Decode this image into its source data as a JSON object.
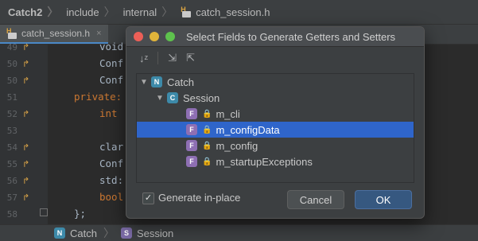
{
  "breadcrumb": {
    "items": [
      "Catch2",
      "include",
      "internal",
      "catch_session.h"
    ]
  },
  "tab": {
    "label": "catch_session.h",
    "close": "×"
  },
  "editor": {
    "lines": [
      {
        "n": "49",
        "text": "void"
      },
      {
        "n": "50",
        "text": "Conf"
      },
      {
        "n": "50",
        "text": "Conf"
      },
      {
        "n": "51",
        "text": "private:"
      },
      {
        "n": "52",
        "text": "int"
      },
      {
        "n": "53",
        "text": ""
      },
      {
        "n": "54",
        "text": "clar"
      },
      {
        "n": "55",
        "text": "Conf"
      },
      {
        "n": "56",
        "text": "std:"
      },
      {
        "n": "57",
        "text": "bool"
      },
      {
        "n": "58",
        "text": "};"
      }
    ]
  },
  "status_bar": {
    "items": [
      {
        "badge": "N",
        "label": "Catch"
      },
      {
        "badge": "S",
        "label": "Session"
      }
    ]
  },
  "dialog": {
    "title": "Select Fields to Generate Getters and Setters",
    "tree": {
      "root": {
        "badge": "N",
        "label": "Catch"
      },
      "class": {
        "badge": "C",
        "label": "Session"
      },
      "fields": [
        {
          "badge": "F",
          "label": "m_cli",
          "selected": false
        },
        {
          "badge": "F",
          "label": "m_configData",
          "selected": true
        },
        {
          "badge": "F",
          "label": "m_config",
          "selected": false
        },
        {
          "badge": "F",
          "label": "m_startupExceptions",
          "selected": false
        }
      ]
    },
    "generate_in_place": {
      "label": "Generate in-place",
      "checked": true
    },
    "buttons": {
      "cancel": "Cancel",
      "ok": "OK"
    }
  },
  "colors": {
    "selection": "#2f65ca",
    "ok_button": "#365880",
    "editor_bg": "#2b2b2b"
  }
}
